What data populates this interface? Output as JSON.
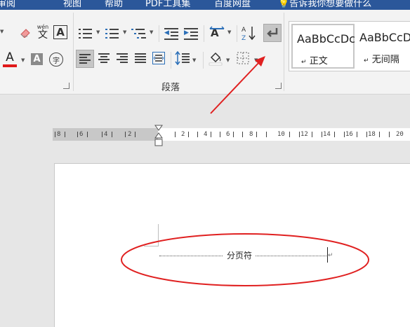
{
  "tabs": [
    "审阅",
    "视图",
    "帮助",
    "PDF工具集",
    "百度网盘",
    "告诉我你想要做什么"
  ],
  "tell_me_icon": "lightbulb-icon",
  "paragraph_group": {
    "label": "段落"
  },
  "font_tools": {
    "clear_format_icon": "eraser-icon",
    "phonetic_label": "wén",
    "phonetic_char": "文",
    "char_border_label": "A",
    "font_color_label": "A",
    "font_color": "#e0191a",
    "char_shading_label": "A",
    "enclose_char_label": "字"
  },
  "styles": [
    {
      "sample": "AaBbCcDc",
      "name": "正文",
      "mark": "↵"
    },
    {
      "sample": "AaBbCcDc",
      "name": "无间隔",
      "mark": "↵"
    }
  ],
  "ruler": {
    "left_labels": [
      "8",
      "6",
      "4",
      "2"
    ],
    "right_labels": [
      "2",
      "4",
      "6",
      "8",
      "10",
      "12",
      "14",
      "16",
      "18",
      "20"
    ]
  },
  "document": {
    "page_break_label": "分页符",
    "para_mark": "↵"
  },
  "annotation": {
    "color": "#e02020"
  }
}
